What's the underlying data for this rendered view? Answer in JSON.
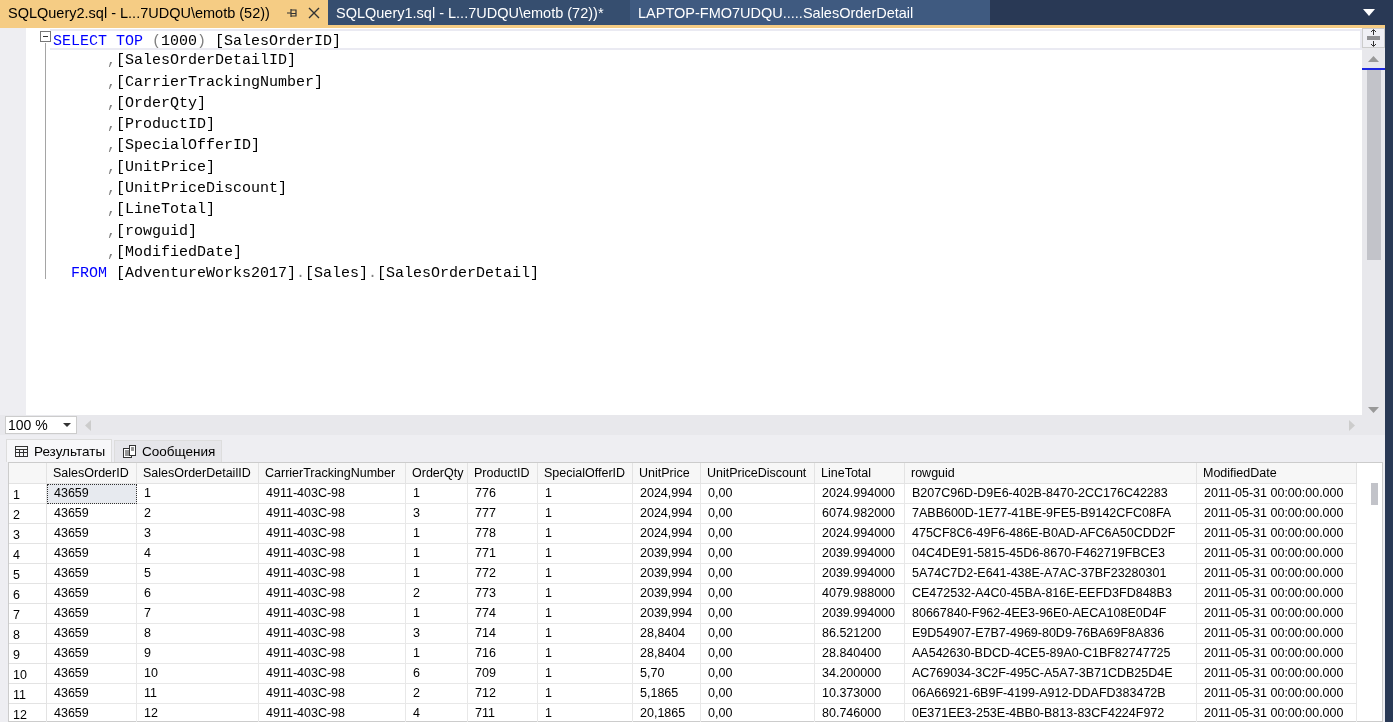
{
  "tabs": [
    {
      "label": "SQLQuery2.sql - L...7UDQU\\emotb (52))",
      "selected": true
    },
    {
      "label": "SQLQuery1.sql - L...7UDQU\\emotb (72))*",
      "selected": false
    },
    {
      "label": "LAPTOP-FMO7UDQU.....SalesOrderDetail",
      "selected": false
    }
  ],
  "editor": {
    "lines": [
      [
        {
          "text": "SELECT",
          "kind": "keyword"
        },
        {
          "text": " TOP",
          "kind": "keyword"
        },
        {
          "text": " (",
          "kind": "punct"
        },
        {
          "text": "1000",
          "kind": "plain"
        },
        {
          "text": ")",
          "kind": "punct"
        },
        {
          "text": " [SalesOrderID]",
          "kind": "plain"
        }
      ],
      [
        {
          "text": "      ,",
          "kind": "punct"
        },
        {
          "text": "[SalesOrderDetailID]",
          "kind": "plain"
        }
      ],
      [
        {
          "text": "      ,",
          "kind": "punct"
        },
        {
          "text": "[CarrierTrackingNumber]",
          "kind": "plain"
        }
      ],
      [
        {
          "text": "      ,",
          "kind": "punct"
        },
        {
          "text": "[OrderQty]",
          "kind": "plain"
        }
      ],
      [
        {
          "text": "      ,",
          "kind": "punct"
        },
        {
          "text": "[ProductID]",
          "kind": "plain"
        }
      ],
      [
        {
          "text": "      ,",
          "kind": "punct"
        },
        {
          "text": "[SpecialOfferID]",
          "kind": "plain"
        }
      ],
      [
        {
          "text": "      ,",
          "kind": "punct"
        },
        {
          "text": "[UnitPrice]",
          "kind": "plain"
        }
      ],
      [
        {
          "text": "      ,",
          "kind": "punct"
        },
        {
          "text": "[UnitPriceDiscount]",
          "kind": "plain"
        }
      ],
      [
        {
          "text": "      ,",
          "kind": "punct"
        },
        {
          "text": "[LineTotal]",
          "kind": "plain"
        }
      ],
      [
        {
          "text": "      ,",
          "kind": "punct"
        },
        {
          "text": "[rowguid]",
          "kind": "plain"
        }
      ],
      [
        {
          "text": "      ,",
          "kind": "punct"
        },
        {
          "text": "[ModifiedDate]",
          "kind": "plain"
        }
      ],
      [
        {
          "text": "  FROM",
          "kind": "keyword"
        },
        {
          "text": " [AdventureWorks2017]",
          "kind": "plain"
        },
        {
          "text": ".",
          "kind": "punct"
        },
        {
          "text": "[Sales]",
          "kind": "plain"
        },
        {
          "text": ".",
          "kind": "punct"
        },
        {
          "text": "[SalesOrderDetail]",
          "kind": "plain"
        }
      ]
    ]
  },
  "zoom": {
    "value": "100 %"
  },
  "result_tabs": [
    {
      "label": "Результаты",
      "selected": true
    },
    {
      "label": "Сообщения",
      "selected": false
    }
  ],
  "grid": {
    "columns": [
      "SalesOrderID",
      "SalesOrderDetailID",
      "CarrierTrackingNumber",
      "OrderQty",
      "ProductID",
      "SpecialOfferID",
      "UnitPrice",
      "UnitPriceDiscount",
      "LineTotal",
      "rowguid",
      "ModifiedDate"
    ],
    "rows": [
      {
        "number": "1",
        "selected": true,
        "cells": [
          "43659",
          "1",
          "4911-403C-98",
          "1",
          "776",
          "1",
          "2024,994",
          "0,00",
          "2024.994000",
          "B207C96D-D9E6-402B-8470-2CC176C42283",
          "2011-05-31 00:00:00.000"
        ]
      },
      {
        "number": "2",
        "selected": false,
        "cells": [
          "43659",
          "2",
          "4911-403C-98",
          "3",
          "777",
          "1",
          "2024,994",
          "0,00",
          "6074.982000",
          "7ABB600D-1E77-41BE-9FE5-B9142CFC08FA",
          "2011-05-31 00:00:00.000"
        ]
      },
      {
        "number": "3",
        "selected": false,
        "cells": [
          "43659",
          "3",
          "4911-403C-98",
          "1",
          "778",
          "1",
          "2024,994",
          "0,00",
          "2024.994000",
          "475CF8C6-49F6-486E-B0AD-AFC6A50CDD2F",
          "2011-05-31 00:00:00.000"
        ]
      },
      {
        "number": "4",
        "selected": false,
        "cells": [
          "43659",
          "4",
          "4911-403C-98",
          "1",
          "771",
          "1",
          "2039,994",
          "0,00",
          "2039.994000",
          "04C4DE91-5815-45D6-8670-F462719FBCE3",
          "2011-05-31 00:00:00.000"
        ]
      },
      {
        "number": "5",
        "selected": false,
        "cells": [
          "43659",
          "5",
          "4911-403C-98",
          "1",
          "772",
          "1",
          "2039,994",
          "0,00",
          "2039.994000",
          "5A74C7D2-E641-438E-A7AC-37BF23280301",
          "2011-05-31 00:00:00.000"
        ]
      },
      {
        "number": "6",
        "selected": false,
        "cells": [
          "43659",
          "6",
          "4911-403C-98",
          "2",
          "773",
          "1",
          "2039,994",
          "0,00",
          "4079.988000",
          "CE472532-A4C0-45BA-816E-EEFD3FD848B3",
          "2011-05-31 00:00:00.000"
        ]
      },
      {
        "number": "7",
        "selected": false,
        "cells": [
          "43659",
          "7",
          "4911-403C-98",
          "1",
          "774",
          "1",
          "2039,994",
          "0,00",
          "2039.994000",
          "80667840-F962-4EE3-96E0-AECA108E0D4F",
          "2011-05-31 00:00:00.000"
        ]
      },
      {
        "number": "8",
        "selected": false,
        "cells": [
          "43659",
          "8",
          "4911-403C-98",
          "3",
          "714",
          "1",
          "28,8404",
          "0,00",
          "86.521200",
          "E9D54907-E7B7-4969-80D9-76BA69F8A836",
          "2011-05-31 00:00:00.000"
        ]
      },
      {
        "number": "9",
        "selected": false,
        "cells": [
          "43659",
          "9",
          "4911-403C-98",
          "1",
          "716",
          "1",
          "28,8404",
          "0,00",
          "28.840400",
          "AA542630-BDCD-4CE5-89A0-C1BF82747725",
          "2011-05-31 00:00:00.000"
        ]
      },
      {
        "number": "10",
        "selected": false,
        "cells": [
          "43659",
          "10",
          "4911-403C-98",
          "6",
          "709",
          "1",
          "5,70",
          "0,00",
          "34.200000",
          "AC769034-3C2F-495C-A5A7-3B71CDB25D4E",
          "2011-05-31 00:00:00.000"
        ]
      },
      {
        "number": "11",
        "selected": false,
        "cells": [
          "43659",
          "11",
          "4911-403C-98",
          "2",
          "712",
          "1",
          "5,1865",
          "0,00",
          "10.373000",
          "06A66921-6B9F-4199-A912-DDAFD383472B",
          "2011-05-31 00:00:00.000"
        ]
      },
      {
        "number": "12",
        "selected": false,
        "cells": [
          "43659",
          "12",
          "4911-403C-98",
          "4",
          "711",
          "1",
          "20,1865",
          "0,00",
          "80.746000",
          "0E371EE3-253E-4BB0-B813-83CF4224F972",
          "2011-05-31 00:00:00.000"
        ]
      }
    ]
  }
}
